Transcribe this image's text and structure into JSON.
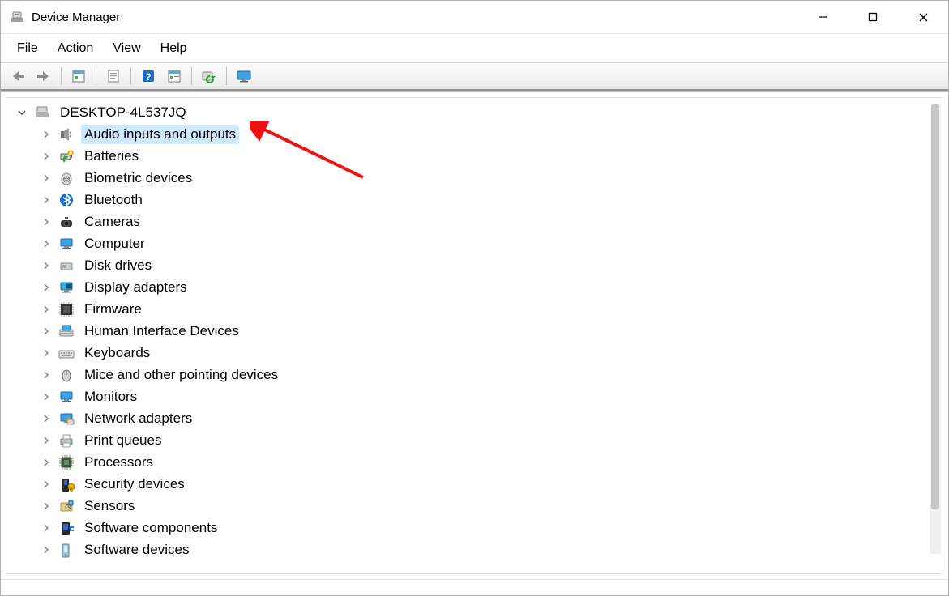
{
  "window": {
    "title": "Device Manager"
  },
  "menu": {
    "file": "File",
    "action": "Action",
    "view": "View",
    "help": "Help"
  },
  "toolbar": {
    "back": "Back",
    "forward": "Forward",
    "properties": "Properties",
    "refresh": "Refresh",
    "help": "Help",
    "showhidden": "Show hidden devices",
    "scan": "Scan for hardware changes",
    "monitor": "Devices and Printers"
  },
  "tree": {
    "root": "DESKTOP-4L537JQ",
    "items": [
      {
        "icon": "speaker-icon",
        "label": "Audio inputs and outputs",
        "selected": true
      },
      {
        "icon": "battery-icon",
        "label": "Batteries"
      },
      {
        "icon": "fingerprint-icon",
        "label": "Biometric devices"
      },
      {
        "icon": "bluetooth-icon",
        "label": "Bluetooth"
      },
      {
        "icon": "camera-icon",
        "label": "Cameras"
      },
      {
        "icon": "computer-icon",
        "label": "Computer"
      },
      {
        "icon": "disk-icon",
        "label": "Disk drives"
      },
      {
        "icon": "display-icon",
        "label": "Display adapters"
      },
      {
        "icon": "firmware-icon",
        "label": "Firmware"
      },
      {
        "icon": "hid-icon",
        "label": "Human Interface Devices"
      },
      {
        "icon": "keyboard-icon",
        "label": "Keyboards"
      },
      {
        "icon": "mouse-icon",
        "label": "Mice and other pointing devices"
      },
      {
        "icon": "monitor-icon",
        "label": "Monitors"
      },
      {
        "icon": "network-icon",
        "label": "Network adapters"
      },
      {
        "icon": "printer-icon",
        "label": "Print queues"
      },
      {
        "icon": "cpu-icon",
        "label": "Processors"
      },
      {
        "icon": "security-icon",
        "label": "Security devices"
      },
      {
        "icon": "sensor-icon",
        "label": "Sensors"
      },
      {
        "icon": "component-icon",
        "label": "Software components"
      },
      {
        "icon": "swdevice-icon",
        "label": "Software devices"
      }
    ]
  }
}
